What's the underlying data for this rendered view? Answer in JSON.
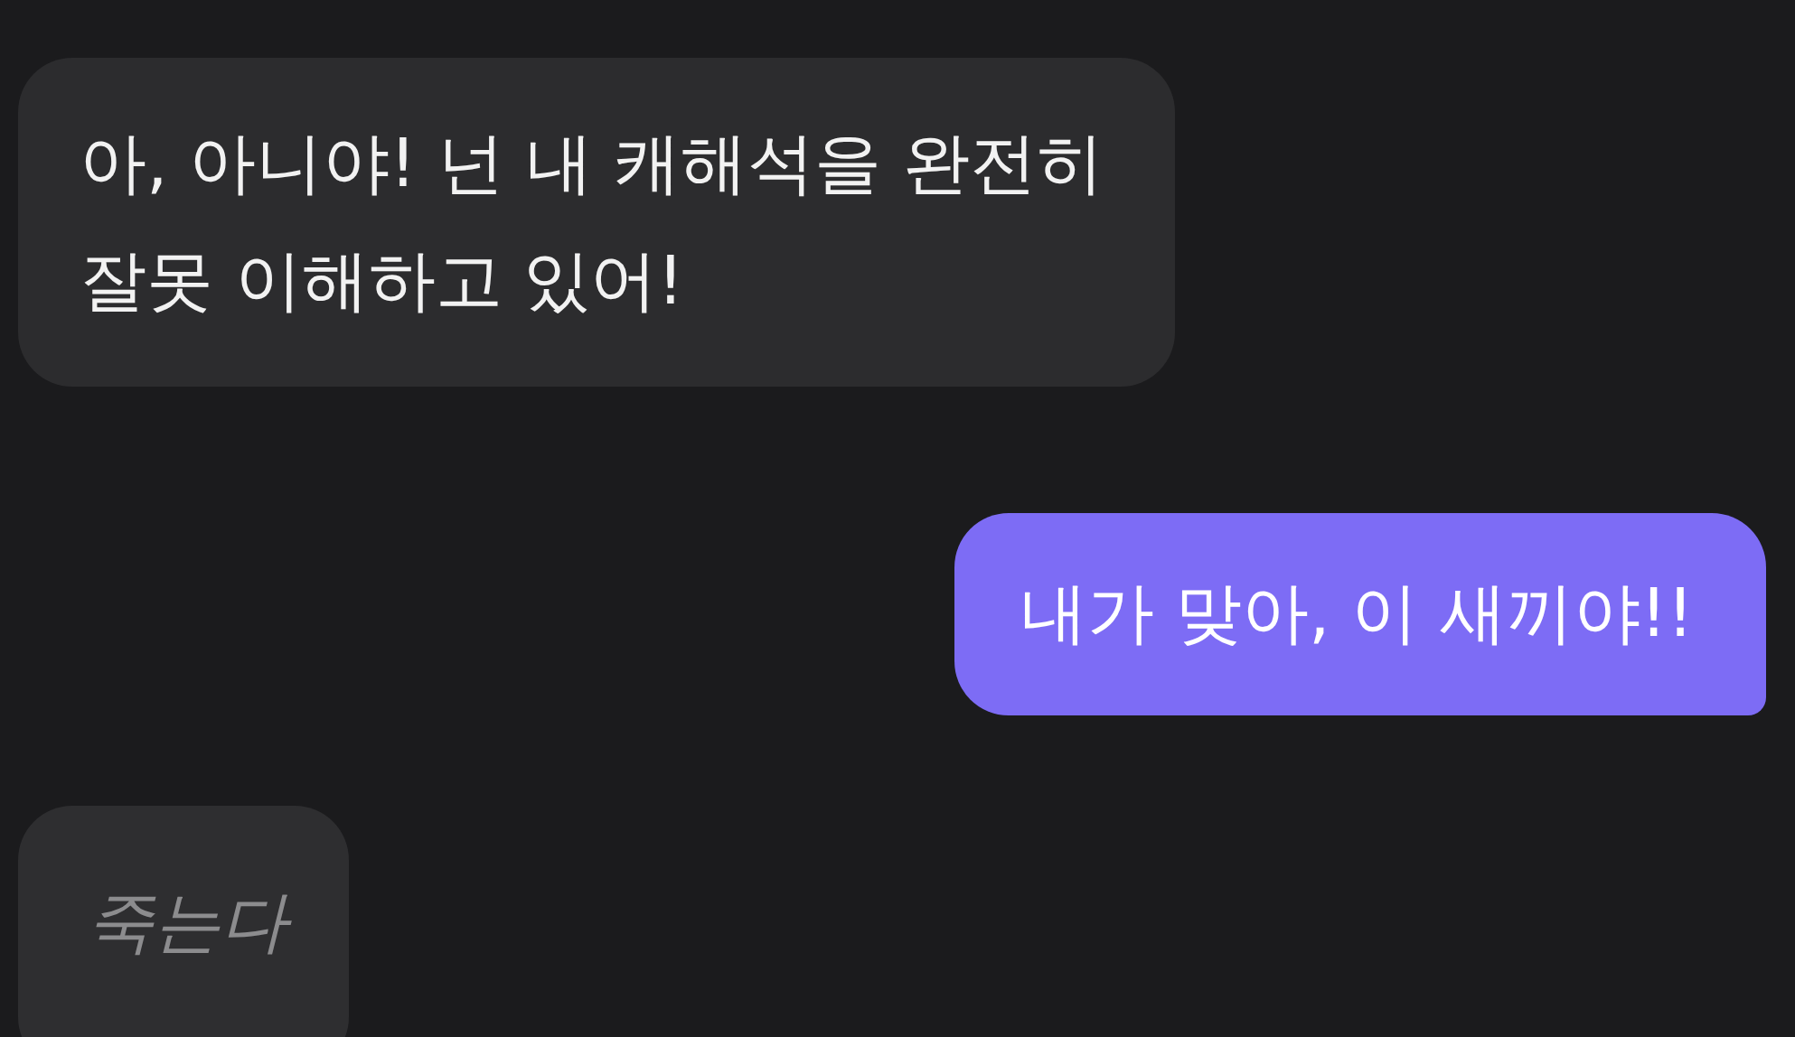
{
  "messages": [
    {
      "kind": "received",
      "text": "아, 아니야! 넌 내 캐해석을 완전히\n잘못 이해하고 있어!"
    },
    {
      "kind": "sent",
      "text": "내가 맞아, 이 새끼야!!"
    },
    {
      "kind": "muted",
      "text": "죽는다"
    }
  ]
}
